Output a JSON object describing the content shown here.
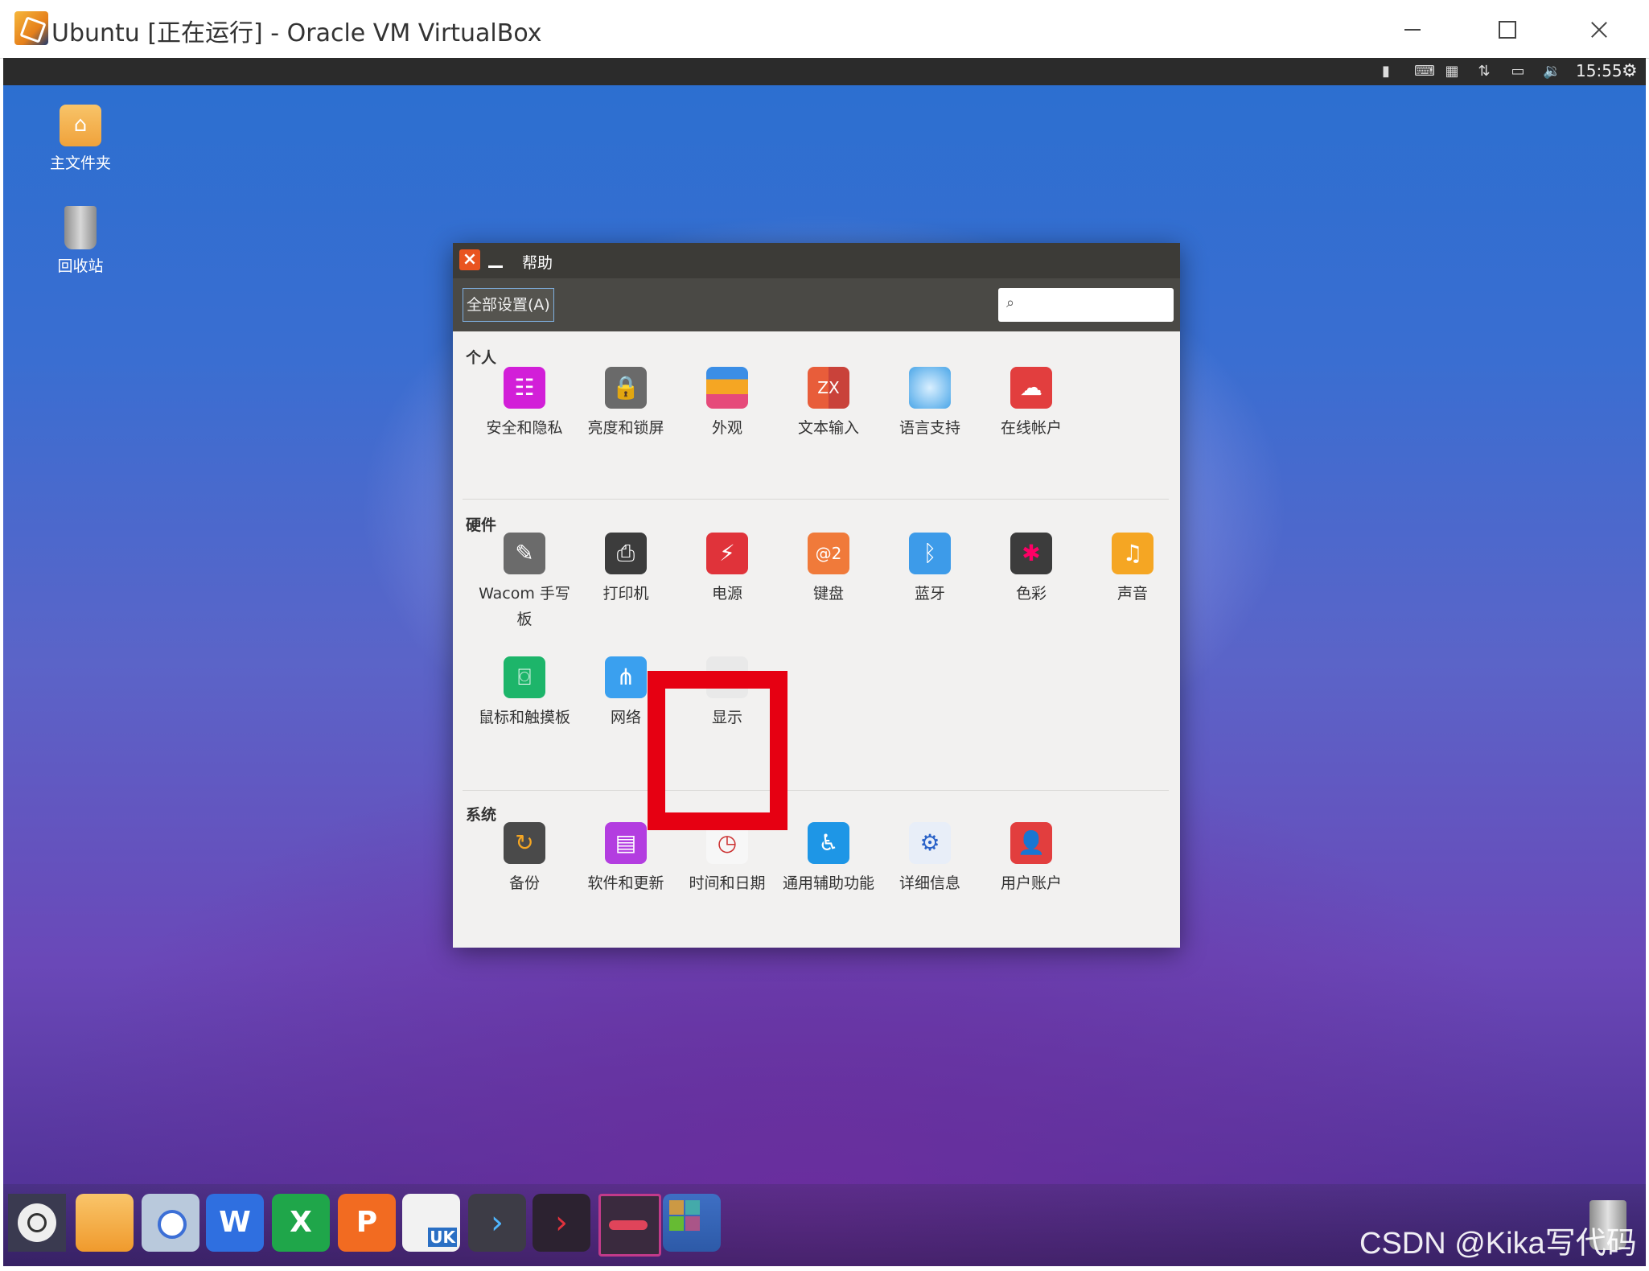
{
  "host": {
    "title": "Ubuntu [正在运行] - Oracle VM VirtualBox"
  },
  "panel": {
    "time": "15:55"
  },
  "desktop": {
    "home_label": "主文件夹",
    "trash_label": "回收站"
  },
  "settings": {
    "window_title": "帮助",
    "all_settings": "全部设置(A)",
    "search_placeholder": "",
    "sections": {
      "personal": "个人",
      "hardware": "硬件",
      "system": "系统"
    },
    "personal_items": [
      "安全和隐私",
      "亮度和锁屏",
      "外观",
      "文本输入",
      "语言支持",
      "在线帐户"
    ],
    "hardware_items": [
      "Wacom 手写板",
      "打印机",
      "电源",
      "键盘",
      "蓝牙",
      "色彩",
      "声音",
      "鼠标和触摸板",
      "网络",
      "显示"
    ],
    "system_items": [
      "备份",
      "软件和更新",
      "时间和日期",
      "通用辅助功能",
      "详细信息",
      "用户账户"
    ]
  },
  "watermark": "CSDN @Kika写代码",
  "colors": {
    "ubuntu_orange": "#e95420",
    "highlight_red": "#e60012"
  }
}
